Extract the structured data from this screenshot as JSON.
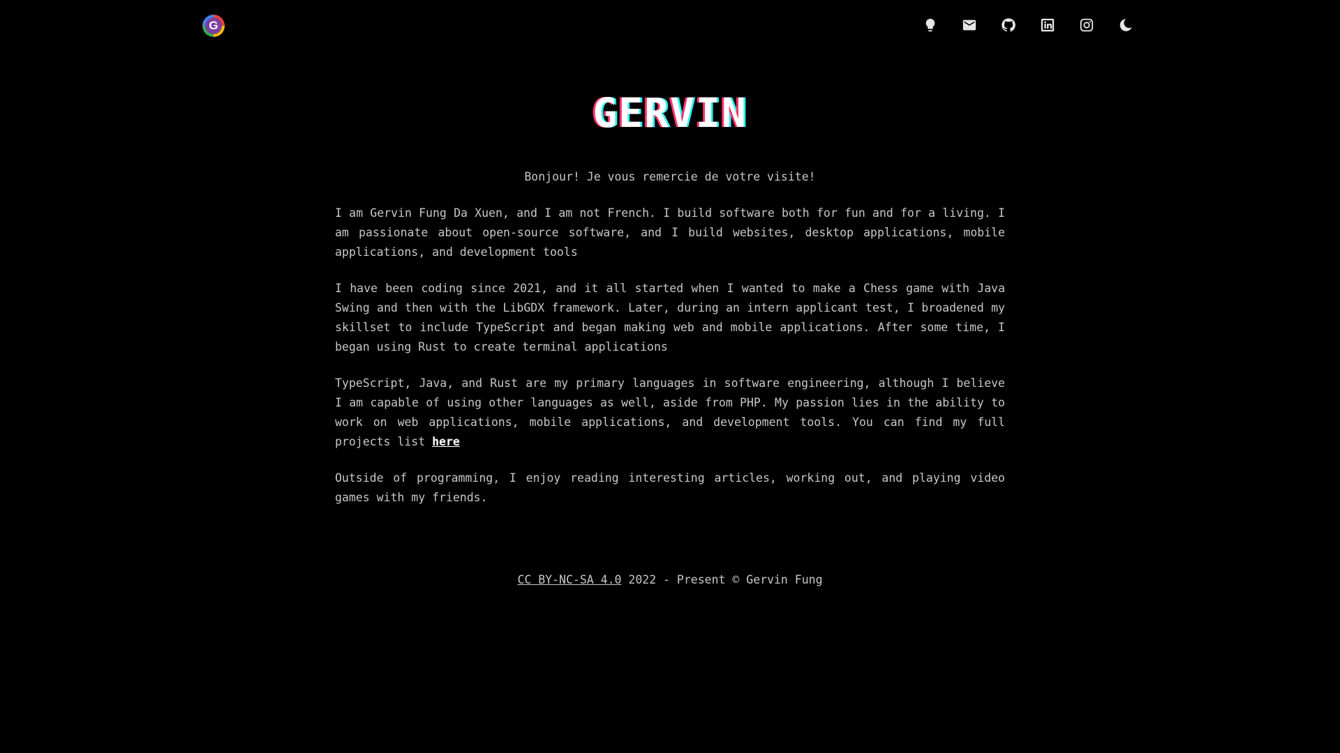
{
  "header": {
    "logo_letter": "G",
    "nav_icons": [
      {
        "name": "lightbulb-icon"
      },
      {
        "name": "mail-icon"
      },
      {
        "name": "github-icon"
      },
      {
        "name": "linkedin-icon"
      },
      {
        "name": "instagram-icon"
      },
      {
        "name": "moon-icon"
      }
    ]
  },
  "main": {
    "title": "GERVIN",
    "greeting": "Bonjour! Je vous remercie de votre visite!",
    "paragraphs": [
      "I am Gervin Fung Da Xuen, and I am not French. I build software both for fun and for a living. I am passionate about open-source software, and I build websites, desktop applications, mobile applications, and development tools",
      "I have been coding since 2021, and it all started when I wanted to make a Chess game with Java Swing and then with the LibGDX framework. Later, during an intern applicant test, I broadened my skillset to include TypeScript and began making web and mobile applications. After some time, I began using Rust to create terminal applications",
      "TypeScript, Java, and Rust are my primary languages in software engineering, although I believe I am capable of using other languages as well, aside from PHP. My passion lies in the ability to work on web applications, mobile applications, and development tools. You can find my full projects list",
      "Outside of programming, I enjoy reading interesting articles, working out, and playing video games with my friends."
    ],
    "projects_link": "here"
  },
  "footer": {
    "license_link": "CC BY-NC-SA 4.0",
    "text": " 2022 - Present © Gervin Fung"
  },
  "colors": {
    "background": "#000000",
    "text": "#c8c8c8",
    "title_red_shadow": "#ff2f6d",
    "title_cyan_shadow": "#2ff2f2"
  }
}
